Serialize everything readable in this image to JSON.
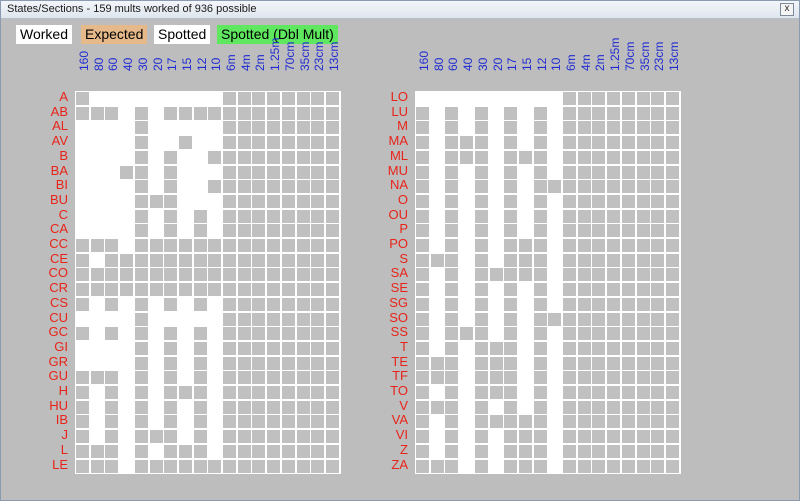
{
  "window": {
    "title": "States/Sections - 159 mults worked of 936 possible",
    "close_label": "x"
  },
  "legend": [
    {
      "label": "Worked",
      "color": "#ffffff"
    },
    {
      "label": "Expected",
      "color": "#e6b98a"
    },
    {
      "label": "Spotted",
      "color": "#ffffff"
    },
    {
      "label": "Spotted (Dbl Mult)",
      "color": "#5fe85f"
    }
  ],
  "bands": [
    "160",
    "80",
    "60",
    "40",
    "30",
    "20",
    "17",
    "15",
    "12",
    "10",
    "6m",
    "4m",
    "2m",
    "1.25m",
    "70cm",
    "35cm",
    "23cm",
    "13cm"
  ],
  "colors": {
    "worked": "#ffffff",
    "empty": "#c0c0c0",
    "row_label": "#e8241a",
    "band_label": "#1f2ad2"
  },
  "left_panel": {
    "rows": [
      {
        "label": "A",
        "worked": [
          1,
          2,
          3,
          4,
          5,
          6,
          7,
          8,
          9
        ]
      },
      {
        "label": "AB",
        "worked": [
          3,
          5
        ]
      },
      {
        "label": "AL",
        "worked": [
          0,
          1,
          2,
          3,
          5,
          6,
          7,
          8,
          9
        ]
      },
      {
        "label": "AV",
        "worked": [
          0,
          1,
          2,
          3,
          5,
          6,
          8,
          9
        ]
      },
      {
        "label": "B",
        "worked": [
          0,
          1,
          2,
          3,
          5,
          7,
          8
        ]
      },
      {
        "label": "BA",
        "worked": [
          0,
          1,
          2,
          5,
          7,
          8,
          9
        ]
      },
      {
        "label": "BI",
        "worked": [
          0,
          1,
          2,
          3,
          5,
          7,
          8
        ]
      },
      {
        "label": "BU",
        "worked": [
          0,
          1,
          2,
          3,
          7,
          8,
          9
        ]
      },
      {
        "label": "C",
        "worked": [
          0,
          1,
          2,
          3,
          5,
          7,
          9
        ]
      },
      {
        "label": "CA",
        "worked": [
          0,
          1,
          2,
          3,
          5,
          7,
          9
        ]
      },
      {
        "label": "CC",
        "worked": [
          3
        ]
      },
      {
        "label": "CE",
        "worked": [
          1
        ]
      },
      {
        "label": "CO",
        "worked": []
      },
      {
        "label": "CR",
        "worked": []
      },
      {
        "label": "CS",
        "worked": [
          1,
          3,
          5,
          7,
          9
        ]
      },
      {
        "label": "CU",
        "worked": [
          0,
          1,
          2,
          3,
          5,
          6,
          7,
          8,
          9
        ]
      },
      {
        "label": "GC",
        "worked": [
          1,
          3,
          5,
          7,
          9
        ]
      },
      {
        "label": "GI",
        "worked": [
          0,
          1,
          2,
          3,
          5,
          7,
          9
        ]
      },
      {
        "label": "GR",
        "worked": [
          0,
          1,
          2,
          3,
          5,
          7,
          9
        ]
      },
      {
        "label": "GU",
        "worked": [
          3,
          5,
          7,
          9
        ]
      },
      {
        "label": "H",
        "worked": [
          1,
          3,
          5,
          9
        ]
      },
      {
        "label": "HU",
        "worked": [
          1,
          3,
          5,
          7,
          9
        ]
      },
      {
        "label": "IB",
        "worked": [
          1,
          3,
          5,
          7,
          9
        ]
      },
      {
        "label": "J",
        "worked": [
          1,
          3,
          7,
          9
        ]
      },
      {
        "label": "L",
        "worked": [
          3,
          5,
          9
        ]
      },
      {
        "label": "LE",
        "worked": [
          3
        ]
      }
    ]
  },
  "right_panel": {
    "rows": [
      {
        "label": "LO",
        "worked": [
          0,
          1,
          2,
          3,
          4,
          5,
          6,
          7,
          8,
          9
        ]
      },
      {
        "label": "LU",
        "worked": [
          1,
          3,
          5,
          7,
          9
        ]
      },
      {
        "label": "M",
        "worked": [
          1,
          3,
          5,
          7,
          9
        ]
      },
      {
        "label": "MA",
        "worked": [
          1,
          5,
          7,
          9
        ]
      },
      {
        "label": "ML",
        "worked": [
          1,
          5,
          9
        ]
      },
      {
        "label": "MU",
        "worked": [
          1,
          3,
          5,
          7,
          9
        ]
      },
      {
        "label": "NA",
        "worked": [
          1,
          3,
          5,
          7
        ]
      },
      {
        "label": "O",
        "worked": [
          1,
          3,
          5,
          7,
          9
        ]
      },
      {
        "label": "OU",
        "worked": [
          1,
          3,
          5,
          7,
          9
        ]
      },
      {
        "label": "P",
        "worked": [
          1,
          3,
          5,
          7,
          9
        ]
      },
      {
        "label": "PO",
        "worked": [
          1,
          3,
          5,
          9
        ]
      },
      {
        "label": "S",
        "worked": [
          3,
          5,
          9
        ]
      },
      {
        "label": "SA",
        "worked": [
          1,
          3,
          9
        ]
      },
      {
        "label": "SE",
        "worked": [
          1,
          3,
          5,
          7,
          9
        ]
      },
      {
        "label": "SG",
        "worked": [
          1,
          3,
          5,
          7,
          9
        ]
      },
      {
        "label": "SO",
        "worked": [
          1,
          3,
          5,
          7
        ]
      },
      {
        "label": "SS",
        "worked": [
          1,
          5,
          7,
          9
        ]
      },
      {
        "label": "T",
        "worked": [
          1,
          3,
          7,
          9
        ]
      },
      {
        "label": "TE",
        "worked": [
          3,
          7,
          9
        ]
      },
      {
        "label": "TF",
        "worked": [
          3,
          7,
          9
        ]
      },
      {
        "label": "TO",
        "worked": [
          1,
          3,
          7,
          9
        ]
      },
      {
        "label": "V",
        "worked": [
          3,
          5,
          7,
          9
        ]
      },
      {
        "label": "VA",
        "worked": [
          1,
          3,
          9
        ]
      },
      {
        "label": "VI",
        "worked": [
          1,
          3,
          5,
          9
        ]
      },
      {
        "label": "Z",
        "worked": [
          1,
          3,
          5,
          9
        ]
      },
      {
        "label": "ZA",
        "worked": [
          3,
          5,
          9
        ]
      }
    ]
  }
}
